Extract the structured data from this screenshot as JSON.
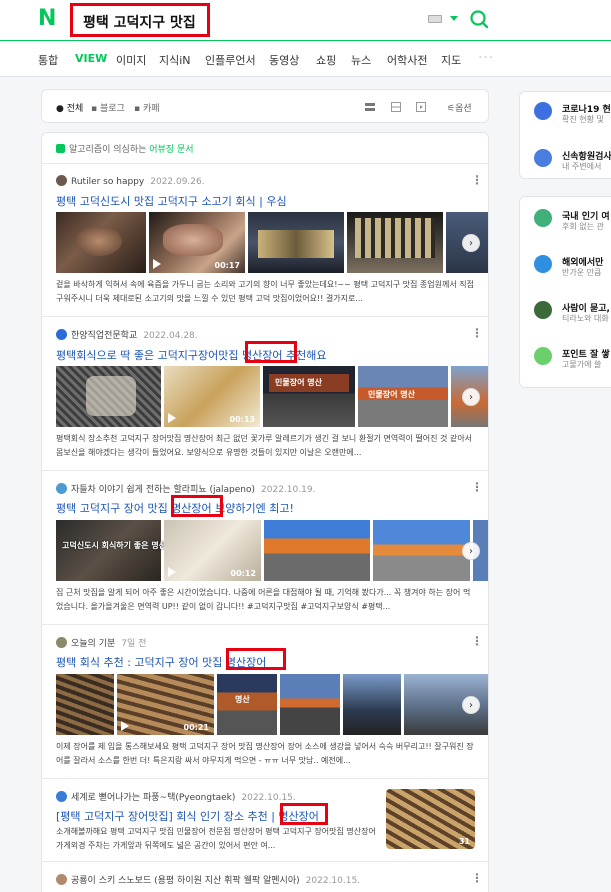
{
  "header": {
    "logo": "N",
    "query": "평택 고덕지구 맛집"
  },
  "tabs": [
    "통합",
    "VIEW",
    "이미지",
    "지식iN",
    "인플루언서",
    "동영상",
    "쇼핑",
    "뉴스",
    "어학사전",
    "지도"
  ],
  "tabs_more": "···",
  "filter": {
    "all": "전체",
    "blog": "블로그",
    "cafe": "카페",
    "options": "옵션"
  },
  "notice": {
    "text": "알고리즘이 의심하는 ",
    "link": "어뷰징 문서"
  },
  "results": [
    {
      "author": "Rutiler so happy",
      "date": "2022.09.26.",
      "title": "평택 고덕신도시 맛집 고덕지구 소고기 회식 | 우심",
      "video_duration": "00:17",
      "desc": "겉을 바삭하게 익혀서 속에 육즙을 가두니 굽는 소리와 고기의 향이 너무 좋았는데요!~~ 평택 고덕지구 맛집 종업원께서 직접 구워주시니 더욱 제대로된 소고기의 맛을 느낄 수 있던 평택 고덕 맛집이었어요!! 결가지로..."
    },
    {
      "author": "한양직업전문학교",
      "date": "2022.04.28.",
      "title_pre": "평택회식으로 딱 좋은 고덕지구장어맛집 ",
      "title_hl": "명산장어",
      "title_post": " 추천해요",
      "video_duration": "00:13",
      "sign1": "민물장어 명산",
      "sign2": "민물장어 명산",
      "desc": "평택회식 장소추천 고덕지구 장어맛집 명산장어 최근 없던 꽃가루 알레르기가 생긴 걸 보니 환절기 면역력이 떨어진 것 같아서 몸보신을 해야겠다는 생각이 들었어요. 보양식으로 유명한 것들이 있지만 이날은 오랜만에..."
    },
    {
      "author": "자들차 이야기 쉽게 전하는 할라피뇨 (jalapeno)",
      "date": "2022.10.19.",
      "title_pre": "평택 고덕지구 장어 맛집 ",
      "title_hl": "명산장어",
      "title_post": " 보양하기엔 최고!",
      "img_text": "고덕신도시 회식하기 좋은 명산장어",
      "video_duration": "00:12",
      "desc": "집 근처 맛집을 알게 되어 아주 좋은 시간이었습니다. 나중에 어른을 대접해야 될 때, 기억해 봤다가... 꼭 챙겨야 하는 장어 먹었습니다. 올가을겨울은 면역력 UP!! 같이 없이 갑니다!! #고덕지구맛집 #고덕지구보양식 #평택..."
    },
    {
      "author": "오늘의 기분",
      "date": "7일 전",
      "title_pre": "평택 회식 추천 : 고덕지구 장어 맛집 ",
      "title_hl": "명산장어",
      "video_duration": "00:21",
      "sign1": "명산",
      "desc": "이제 장어를 제 입을 통스해보세요 평택 고덕지구 장어 맛집 명산장어 장어 소스에 생강을 넣어서 슥슥 버무리고!! 잘구워진 장어를 잘라서 소스를 한번 더! 특은지랑 싸서 야무지게 먹으면 - ㅠㅠ 너무 맛남.. 예전에..."
    },
    {
      "author": "세계로 뻗어나가는 파풍~택(Pyeongtaek)",
      "date": "2022.10.15.",
      "title_pre": "[평택 고덕지구 장어맛집] 회식 인기 장소 추천 | ",
      "title_hl": "명산장어",
      "thumb_count": "31",
      "desc": "소개해볼까해요 평택 고덕지구 맛집 민물장어 전문점 명산장어 평택 고덕지구 장어맛집 명산장어 가게외경 주차는 가게앞과 뒤쪽에도 넓은 공간이 있어서 편안 여..."
    },
    {
      "author": "공룡이 스키 스노보드 (용평 하이원 지산 휘팍 웰팍 알펜시아)",
      "date": "2022.10.15."
    }
  ],
  "sidebar": {
    "group1": [
      {
        "title": "코로나19 현",
        "sub": "확진 현황 및"
      },
      {
        "title": "신속항원검사",
        "sub": "내 주변에서"
      }
    ],
    "group2": [
      {
        "title": "국내 인기 여",
        "sub": "후회 없는 관"
      },
      {
        "title": "해외에서만",
        "sub": "반가운 만큼"
      },
      {
        "title": "사람이 묻고,",
        "sub": "티라노와 대화"
      },
      {
        "title": "포인트 잘 쌓",
        "sub": "고물가에 쓸"
      }
    ]
  },
  "colors": {
    "brand": "#03c75a",
    "link": "#1b55b5",
    "highlight_box": "#e60012"
  },
  "icons": [
    "search-icon",
    "keyboard-icon",
    "play-icon",
    "more-icon",
    "next-arrow-icon",
    "options-icon"
  ]
}
